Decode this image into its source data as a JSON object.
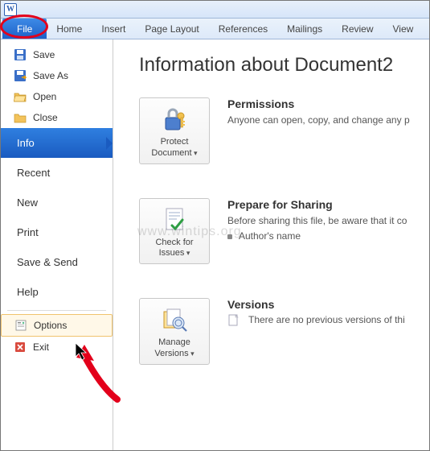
{
  "titlebar": {
    "app_letter": "W"
  },
  "tabs": {
    "file": "File",
    "items": [
      "Home",
      "Insert",
      "Page Layout",
      "References",
      "Mailings",
      "Review",
      "View"
    ]
  },
  "backstage": {
    "save": "Save",
    "save_as": "Save As",
    "open": "Open",
    "close": "Close",
    "info": "Info",
    "recent": "Recent",
    "new": "New",
    "print": "Print",
    "save_send": "Save & Send",
    "help": "Help",
    "options": "Options",
    "exit": "Exit"
  },
  "content": {
    "heading": "Information about Document2",
    "permissions": {
      "title": "Permissions",
      "desc": "Anyone can open, copy, and change any p",
      "button_l1": "Protect",
      "button_l2": "Document"
    },
    "sharing": {
      "title": "Prepare for Sharing",
      "desc": "Before sharing this file, be aware that it co",
      "bullet": "Author's name",
      "button_l1": "Check for",
      "button_l2": "Issues"
    },
    "versions": {
      "title": "Versions",
      "desc": "There are no previous versions of thi",
      "button_l1": "Manage",
      "button_l2": "Versions"
    }
  },
  "watermark": "www.wintips.org"
}
